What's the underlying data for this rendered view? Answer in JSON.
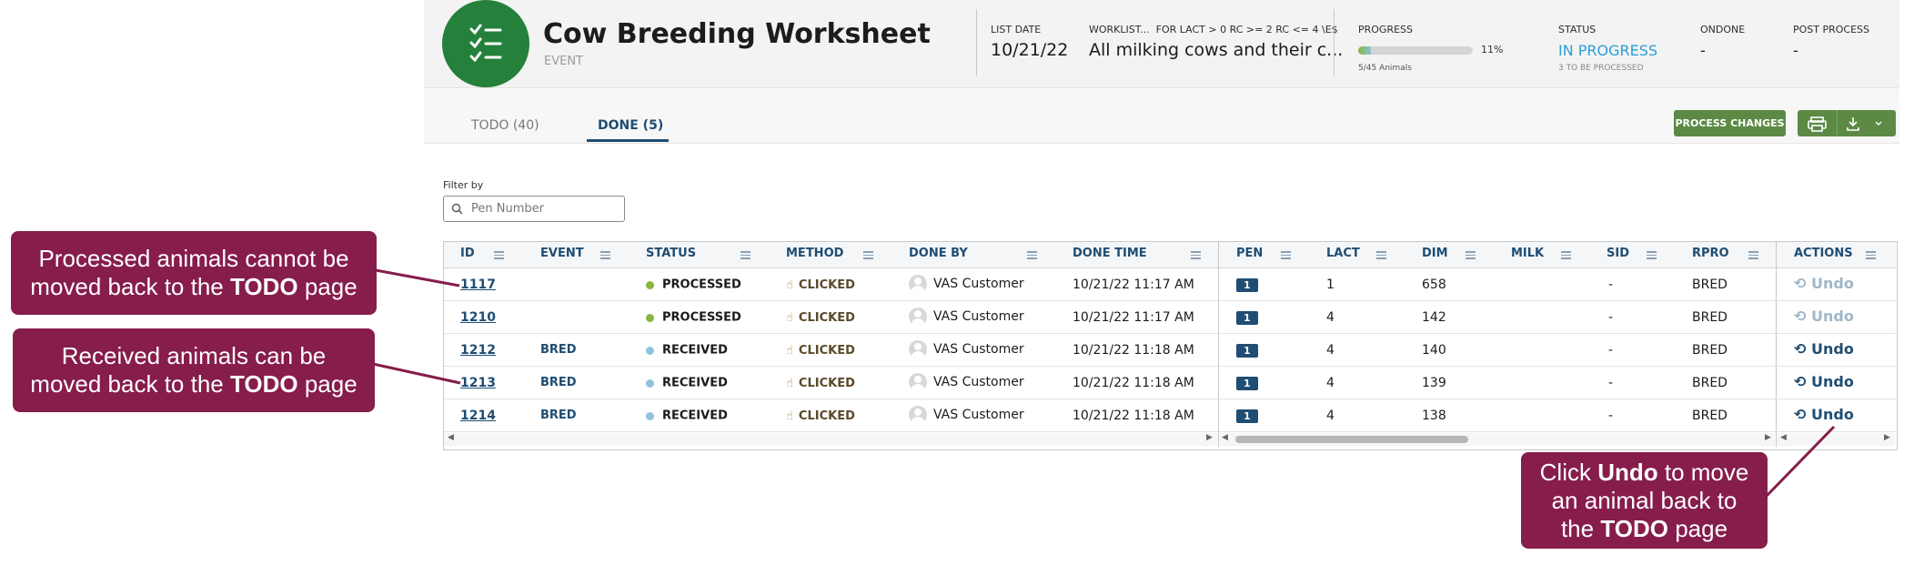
{
  "header": {
    "title": "Cow Breeding Worksheet",
    "subtitle": "EVENT",
    "list_date_label": "LIST DATE",
    "list_date": "10/21/22",
    "worklist_label": "WORKLIST...",
    "worklist_criteria": "FOR LACT > 0 RC >= 2 RC <= 4 \\E$",
    "worklist_value": "All milking cows and their c...",
    "progress_label": "PROGRESS",
    "progress_percent": "11%",
    "progress_fraction": 0.11,
    "progress_count": "5/45 Animals",
    "status_label": "STATUS",
    "status_value": "IN PROGRESS",
    "status_sub": "3 TO BE PROCESSED",
    "ondone_label": "ONDONE",
    "ondone_value": "-",
    "post_process_label": "POST PROCESS",
    "post_process_value": "-"
  },
  "tabs": [
    {
      "label": "TODO (40)"
    },
    {
      "label": "DONE (5)"
    }
  ],
  "toolbar": {
    "process_changes": "PROCESS CHANGES"
  },
  "filter": {
    "label": "Filter by",
    "placeholder": "Pen Number"
  },
  "table": {
    "columns": [
      "ID",
      "EVENT",
      "STATUS",
      "METHOD",
      "DONE BY",
      "DONE TIME",
      "PEN",
      "LACT",
      "DIM",
      "MILK",
      "SID",
      "RPRO",
      "ACTIONS"
    ],
    "rows": [
      {
        "id": "1117",
        "event": "",
        "status": "PROCESSED",
        "method": "CLICKED",
        "done_by": "VAS Customer",
        "done_time": "10/21/22 11:17 AM",
        "pen": "1",
        "lact": "1",
        "dim": "658",
        "milk": "",
        "sid": "-",
        "rpro": "BRED",
        "action": "Undo"
      },
      {
        "id": "1210",
        "event": "",
        "status": "PROCESSED",
        "method": "CLICKED",
        "done_by": "VAS Customer",
        "done_time": "10/21/22 11:17 AM",
        "pen": "1",
        "lact": "4",
        "dim": "142",
        "milk": "",
        "sid": "-",
        "rpro": "BRED",
        "action": "Undo"
      },
      {
        "id": "1212",
        "event": "BRED",
        "status": "RECEIVED",
        "method": "CLICKED",
        "done_by": "VAS Customer",
        "done_time": "10/21/22 11:18 AM",
        "pen": "1",
        "lact": "4",
        "dim": "140",
        "milk": "",
        "sid": "-",
        "rpro": "BRED",
        "action": "Undo"
      },
      {
        "id": "1213",
        "event": "BRED",
        "status": "RECEIVED",
        "method": "CLICKED",
        "done_by": "VAS Customer",
        "done_time": "10/21/22 11:18 AM",
        "pen": "1",
        "lact": "4",
        "dim": "139",
        "milk": "",
        "sid": "-",
        "rpro": "BRED",
        "action": "Undo"
      },
      {
        "id": "1214",
        "event": "BRED",
        "status": "RECEIVED",
        "method": "CLICKED",
        "done_by": "VAS Customer",
        "done_time": "10/21/22 11:18 AM",
        "pen": "1",
        "lact": "4",
        "dim": "138",
        "milk": "",
        "sid": "-",
        "rpro": "BRED",
        "action": "Undo"
      }
    ]
  },
  "callouts": {
    "c1_pre": "Processed animals cannot be moved back to the ",
    "c1_bold": "TODO",
    "c1_post": " page",
    "c2_pre": "Received animals can be moved back to the ",
    "c2_bold": "TODO",
    "c2_post": " page",
    "c3_pre": "Click ",
    "c3_bold1": "Undo",
    "c3_mid": " to move an animal back to the ",
    "c3_bold2": "TODO",
    "c3_post": " page"
  },
  "colors": {
    "brand_green": "#24803a",
    "status_blue": "#2a9fd6",
    "processed_dot": "#86b83f",
    "received_dot": "#8fc3dc",
    "callout": "#861d4b",
    "header_blue": "#1f4d73"
  }
}
